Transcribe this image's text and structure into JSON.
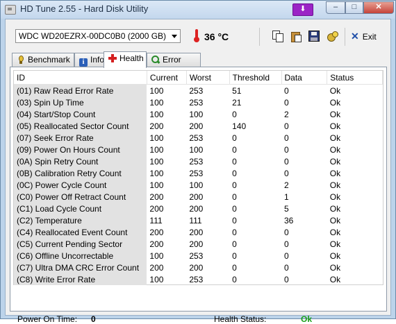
{
  "window": {
    "title": "HD Tune 2.55 - Hard Disk Utility",
    "controls": {
      "minimize": "–",
      "maximize": "□",
      "close": "✕"
    },
    "extra_button": "⬇"
  },
  "toolbar": {
    "drive": "WDC WD20EZRX-00DC0B0 (2000 GB)",
    "temperature": "36 °C",
    "exit_label": "Exit"
  },
  "tabs": [
    {
      "label": "Benchmark",
      "icon": "benchmark-icon"
    },
    {
      "label": "Info",
      "icon": "info-icon"
    },
    {
      "label": "Health",
      "icon": "health-cross-icon",
      "active": true
    },
    {
      "label": "Error Scan",
      "icon": "search-icon"
    }
  ],
  "table": {
    "headers": [
      "ID",
      "Current",
      "Worst",
      "Threshold",
      "Data",
      "Status"
    ],
    "rows": [
      [
        "(01) Raw Read Error Rate",
        "100",
        "253",
        "51",
        "0",
        "Ok"
      ],
      [
        "(03) Spin Up Time",
        "100",
        "253",
        "21",
        "0",
        "Ok"
      ],
      [
        "(04) Start/Stop Count",
        "100",
        "100",
        "0",
        "2",
        "Ok"
      ],
      [
        "(05) Reallocated Sector Count",
        "200",
        "200",
        "140",
        "0",
        "Ok"
      ],
      [
        "(07) Seek Error Rate",
        "100",
        "253",
        "0",
        "0",
        "Ok"
      ],
      [
        "(09) Power On Hours Count",
        "100",
        "100",
        "0",
        "0",
        "Ok"
      ],
      [
        "(0A) Spin Retry Count",
        "100",
        "253",
        "0",
        "0",
        "Ok"
      ],
      [
        "(0B) Calibration Retry Count",
        "100",
        "253",
        "0",
        "0",
        "Ok"
      ],
      [
        "(0C) Power Cycle Count",
        "100",
        "100",
        "0",
        "2",
        "Ok"
      ],
      [
        "(C0) Power Off Retract Count",
        "200",
        "200",
        "0",
        "1",
        "Ok"
      ],
      [
        "(C1) Load Cycle Count",
        "200",
        "200",
        "0",
        "5",
        "Ok"
      ],
      [
        "(C2) Temperature",
        "111",
        "111",
        "0",
        "36",
        "Ok"
      ],
      [
        "(C4) Reallocated Event Count",
        "200",
        "200",
        "0",
        "0",
        "Ok"
      ],
      [
        "(C5) Current Pending Sector",
        "200",
        "200",
        "0",
        "0",
        "Ok"
      ],
      [
        "(C6) Offline Uncorrectable",
        "100",
        "253",
        "0",
        "0",
        "Ok"
      ],
      [
        "(C7) Ultra DMA CRC Error Count",
        "200",
        "200",
        "0",
        "0",
        "Ok"
      ],
      [
        "(C8) Write Error Rate",
        "100",
        "253",
        "0",
        "0",
        "Ok"
      ]
    ]
  },
  "footer": {
    "power_on_label": "Power On Time:",
    "power_on_value": "0",
    "health_label": "Health Status:",
    "health_value": "Ok",
    "health_color": "#1aa01a"
  }
}
